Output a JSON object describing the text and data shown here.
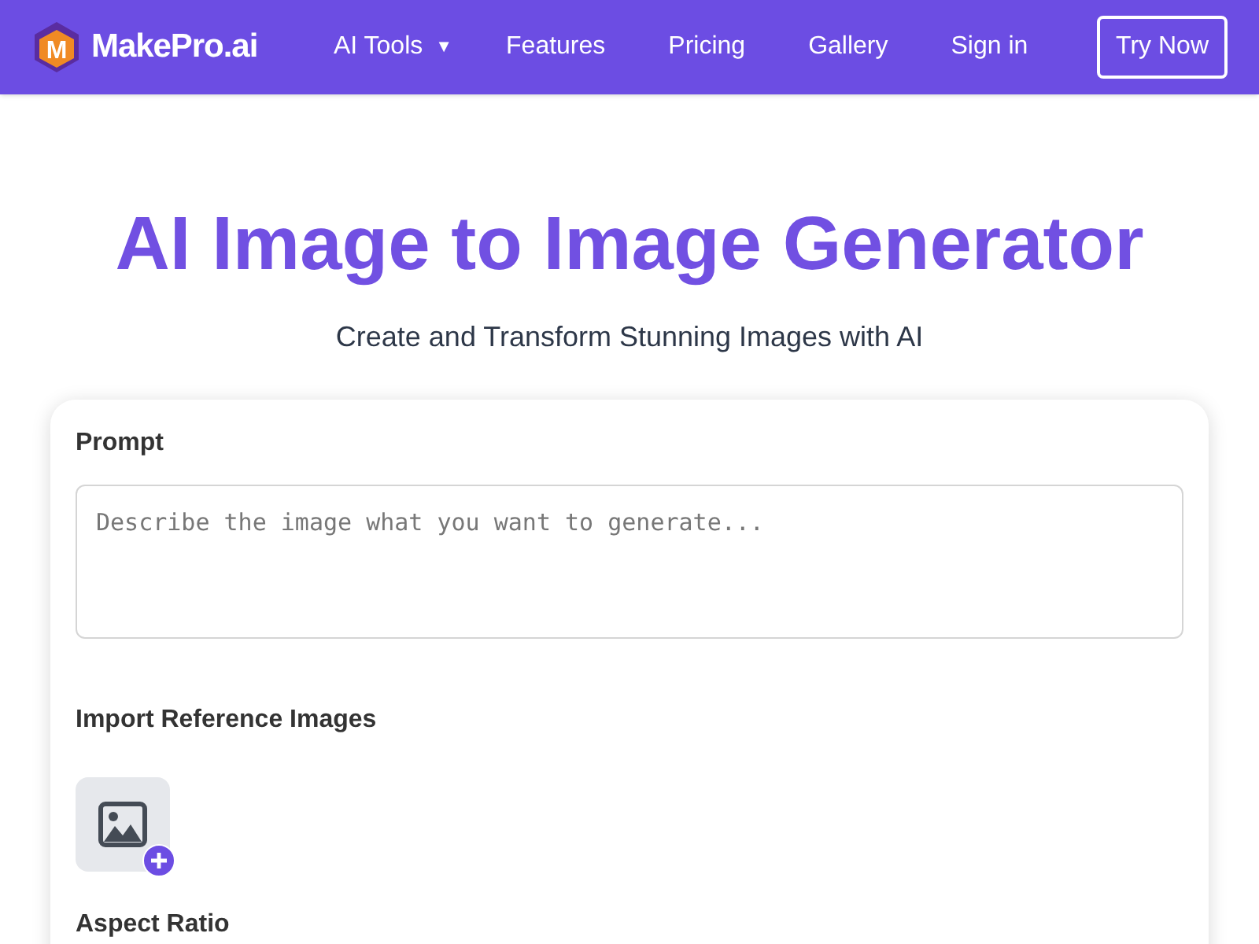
{
  "header": {
    "logo": {
      "letter": "M",
      "name": "MakePro.ai"
    },
    "nav": [
      {
        "label": "AI Tools",
        "caret": "▼"
      },
      {
        "label": "Features"
      },
      {
        "label": "Pricing"
      },
      {
        "label": "Gallery"
      },
      {
        "label": "Sign in"
      }
    ],
    "cta": "Try Now"
  },
  "hero": {
    "title": "AI Image to Image Generator",
    "subtitle": "Create and Transform Stunning Images with AI"
  },
  "form": {
    "prompt": {
      "label": "Prompt",
      "placeholder": "Describe the image what you want to generate..."
    },
    "reference": {
      "label": "Import Reference Images"
    },
    "aspect_ratio": {
      "label": "Aspect Ratio"
    }
  }
}
